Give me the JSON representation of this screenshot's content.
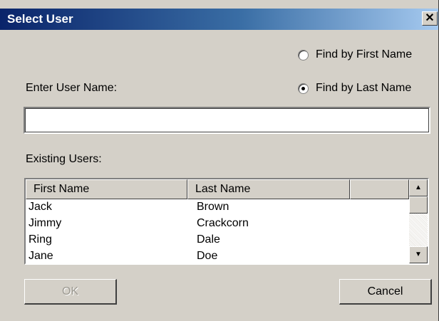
{
  "window": {
    "title": "Select User",
    "close_glyph": "✕"
  },
  "search_mode": {
    "options": [
      {
        "label": "Find by First Name",
        "checked": false
      },
      {
        "label": "Find by Last Name",
        "checked": true
      }
    ]
  },
  "user_name": {
    "label": "Enter User Name:",
    "value": ""
  },
  "existing_users": {
    "label": "Existing Users:",
    "columns": [
      "First Name",
      "Last Name",
      ""
    ],
    "rows": [
      {
        "first": "Jack",
        "last": "Brown"
      },
      {
        "first": "Jimmy",
        "last": "Crackcorn"
      },
      {
        "first": "Ring",
        "last": "Dale"
      },
      {
        "first": "Jane",
        "last": "Doe"
      }
    ]
  },
  "buttons": {
    "ok": "OK",
    "cancel": "Cancel"
  },
  "icons": {
    "scroll_up": "scroll-up-arrow-icon",
    "scroll_down": "scroll-down-arrow-icon"
  }
}
